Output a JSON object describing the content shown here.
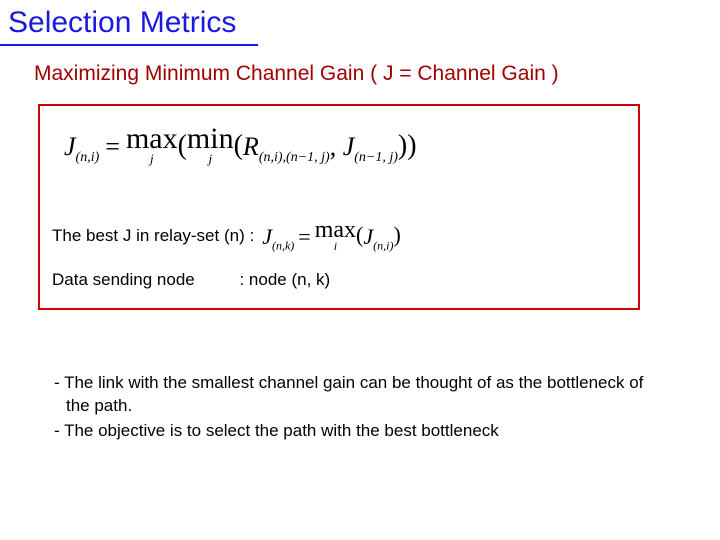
{
  "title": "Selection Metrics",
  "subtitle": "Maximizing Minimum Channel Gain ( J = Channel Gain )",
  "formula1": {
    "J": "J",
    "J_sub": "(n,i)",
    "eq": "=",
    "max": "max",
    "max_sub": "j",
    "lp": "(",
    "min": "min",
    "min_sub": "j",
    "lp2": "(",
    "R": "R",
    "R_sub": "(n,i),(n−1, j)",
    "comma": ", ",
    "J2": "J",
    "J2_sub": "(n−1, j)",
    "rp2": ")",
    "rp": ")"
  },
  "line2_label": "The best J in relay-set (n) :",
  "formula2": {
    "J": "J",
    "J_sub": "(n,k)",
    "eq": "=",
    "max": "max",
    "max_sub": "i",
    "lp": "(",
    "Jarg": "J",
    "Jarg_sub": "(n,i)",
    "rp": ")"
  },
  "line3_label": "Data sending node",
  "line3_value": ":   node (n, k)",
  "bullet1": "- The link with the smallest channel gain can be thought of as the bottleneck of the path.",
  "bullet2": "- The objective is to select the path with the best bottleneck"
}
